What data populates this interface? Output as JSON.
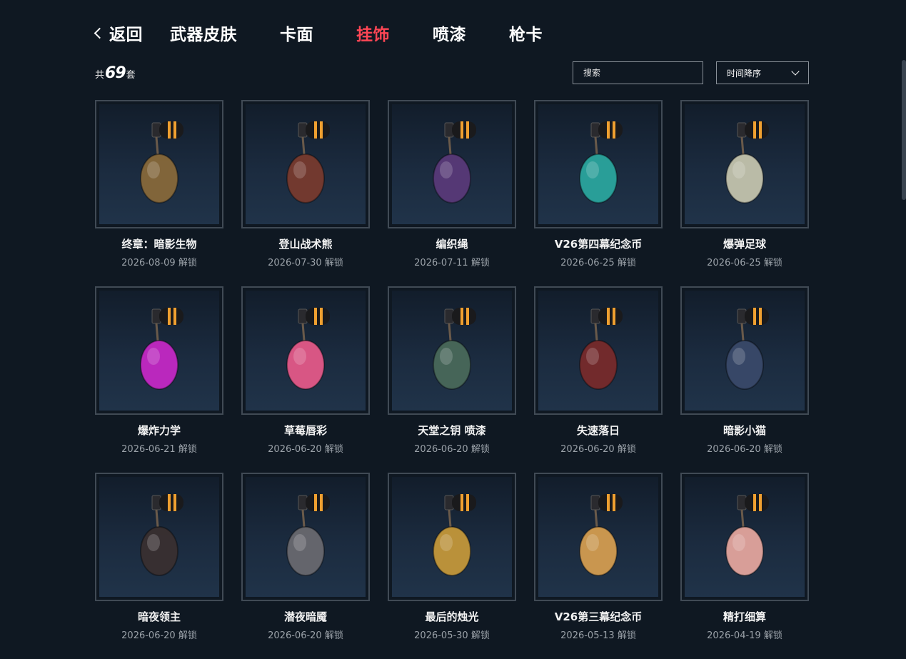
{
  "nav": {
    "back_label": "返回",
    "tabs": [
      {
        "label": "武器皮肤",
        "active": false
      },
      {
        "label": "卡面",
        "active": false
      },
      {
        "label": "挂饰",
        "active": true
      },
      {
        "label": "喷漆",
        "active": false
      },
      {
        "label": "枪卡",
        "active": false
      }
    ]
  },
  "summary": {
    "prefix": "共",
    "count": "69",
    "suffix": "套"
  },
  "search": {
    "placeholder": "搜索"
  },
  "sort": {
    "selected": "时间降序"
  },
  "colors": {
    "accent": "#ff4655",
    "background": "#0f1822",
    "card_border": "#404a55"
  },
  "items": [
    {
      "name": "终章：暗影生物",
      "date": "2026-08-09 解锁",
      "icon": "shadow-creature-charm-icon",
      "color": "#8a6a3a"
    },
    {
      "name": "登山战术熊",
      "date": "2026-07-30 解锁",
      "icon": "climbing-bear-charm-icon",
      "color": "#7a3b2e"
    },
    {
      "name": "编织绳",
      "date": "2026-07-11 解锁",
      "icon": "braided-rope-charm-icon",
      "color": "#5a3a7a"
    },
    {
      "name": "V26第四幕纪念币",
      "date": "2026-06-25 解锁",
      "icon": "v26-act4-coin-charm-icon",
      "color": "#2aa8a0"
    },
    {
      "name": "爆弹足球",
      "date": "2026-06-25 解锁",
      "icon": "spike-football-charm-icon",
      "color": "#c8c8b0"
    },
    {
      "name": "爆炸力学",
      "date": "2026-06-21 解锁",
      "icon": "explosion-mechanics-charm-icon",
      "color": "#c828c8"
    },
    {
      "name": "草莓唇彩",
      "date": "2026-06-20 解锁",
      "icon": "strawberry-lipgloss-charm-icon",
      "color": "#e85a8a"
    },
    {
      "name": "天堂之钥 喷漆",
      "date": "2026-06-20 解锁",
      "icon": "heaven-key-pegasus-charm-icon",
      "color": "#4a6a5a"
    },
    {
      "name": "失速落日",
      "date": "2026-06-20 解锁",
      "icon": "stalling-sunset-charm-icon",
      "color": "#7a2a2a"
    },
    {
      "name": "暗影小猫",
      "date": "2026-06-20 解锁",
      "icon": "shadow-kitten-charm-icon",
      "color": "#3a4a6a"
    },
    {
      "name": "暗夜领主",
      "date": "2026-06-20 解锁",
      "icon": "night-lord-charm-icon",
      "color": "#3a3030"
    },
    {
      "name": "潜夜暗魇",
      "date": "2026-06-20 解锁",
      "icon": "night-nightmare-charm-icon",
      "color": "#6a6a70"
    },
    {
      "name": "最后的烛光",
      "date": "2026-05-30 解锁",
      "icon": "last-candlelight-charm-icon",
      "color": "#c89a3a"
    },
    {
      "name": "V26第三幕纪念币",
      "date": "2026-05-13 解锁",
      "icon": "v26-act3-coin-charm-icon",
      "color": "#d8a050"
    },
    {
      "name": "精打细算",
      "date": "2026-04-19 解锁",
      "icon": "piggy-bank-charm-icon",
      "color": "#e8a8a0"
    }
  ]
}
